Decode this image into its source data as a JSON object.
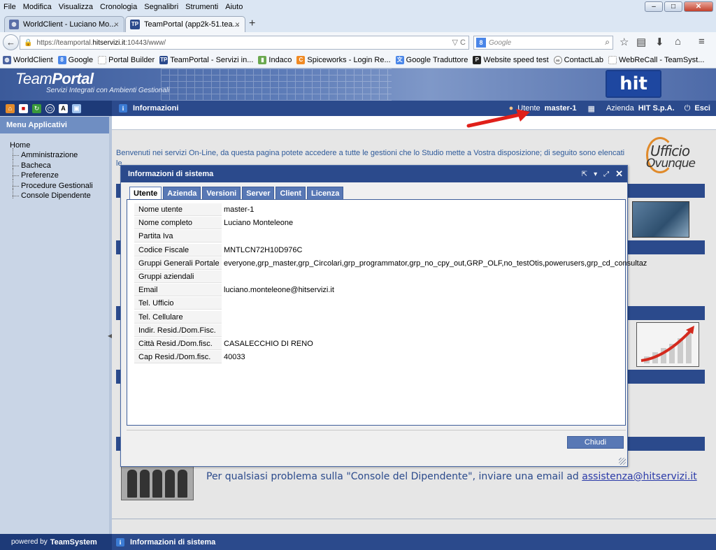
{
  "browser": {
    "menu": [
      "File",
      "Modifica",
      "Visualizza",
      "Cronologia",
      "Segnalibri",
      "Strumenti",
      "Aiuto"
    ],
    "window_controls": {
      "minimize": "–",
      "maximize": "□",
      "close": "✕"
    },
    "tabs": [
      {
        "label": "WorldClient - Luciano Mo...",
        "icon": "worldclient-icon",
        "active": false
      },
      {
        "label": "TeamPortal (app2k-51.tea...",
        "icon": "tp-icon",
        "active": true
      }
    ],
    "new_tab": "+",
    "back": "←",
    "url": {
      "prefix": "https://teamportal.",
      "domain": "hitservizi.it",
      "suffix": ":10443/www/",
      "controls": "▽ C"
    },
    "search": {
      "placeholder": "Google",
      "engine_badge": "8",
      "icon": "⌕"
    },
    "nav_icons": [
      "☆",
      "▤",
      "⬇",
      "⌂",
      "≡"
    ],
    "bookmarks": [
      {
        "label": "WorldClient",
        "icon": "globe-icon"
      },
      {
        "label": "Google",
        "icon": "google-icon"
      },
      {
        "label": "Portal Builder",
        "icon": "page-icon"
      },
      {
        "label": "TeamPortal - Servizi in...",
        "icon": "tp-icon"
      },
      {
        "label": "Indaco",
        "icon": "chart-icon"
      },
      {
        "label": "Spiceworks - Login Re...",
        "icon": "spiceworks-icon"
      },
      {
        "label": "Google Traduttore",
        "icon": "translate-icon"
      },
      {
        "label": "Website speed test",
        "icon": "p-icon"
      },
      {
        "label": "ContactLab",
        "icon": "contactlab-icon"
      },
      {
        "label": "WebReCall - TeamSyst...",
        "icon": "page-icon"
      }
    ]
  },
  "app": {
    "brand_team": "Team",
    "brand_portal": "Portal",
    "brand_sub": "Servizi Integrati con Ambienti Gestionali",
    "hit_logo": "hit",
    "toolbar_icons": [
      "home-icon",
      "flag-icon",
      "refresh-icon",
      "power-icon",
      "font-icon",
      "windows-icon"
    ],
    "section_title": "Informazioni",
    "user_label": "Utente",
    "user_value": "master-1",
    "company_label": "Azienda",
    "company_value": "HIT S.p.A.",
    "logout_label": "Esci",
    "sidebar_title": "Menu Applicativi",
    "tree_root": "Home",
    "tree_items": [
      "Amministrazione",
      "Bacheca",
      "Preferenze",
      "Procedure Gestionali",
      "Console Dipendente"
    ],
    "welcome_text": "Benvenuti nei servizi On-Line, da questa pagina potete accedere a tutte le gestioni che lo Studio mette a Vostra disposizione; di seguito sono elencati le",
    "ufficio_1": "Ufficio",
    "ufficio_2": "Ovunque",
    "bottom_text": "Per qualsiasi problema sulla \"Console del Dipendente\", inviare una email ad",
    "bottom_email": "assistenza@hitservizi.it",
    "powered_by": "powered by",
    "powered_brand": "TeamSystem",
    "status_title": "Informazioni di sistema"
  },
  "dialog": {
    "title": "Informazioni di sistema",
    "header_buttons": [
      "⇱",
      "▾",
      "⤢",
      "✕"
    ],
    "tabs": [
      "Utente",
      "Azienda",
      "Versioni",
      "Server",
      "Client",
      "Licenza"
    ],
    "active_tab": "Utente",
    "rows": [
      {
        "label": "Nome utente",
        "value": "master-1"
      },
      {
        "label": "Nome completo",
        "value": "Luciano Monteleone"
      },
      {
        "label": "Partita Iva",
        "value": ""
      },
      {
        "label": "Codice Fiscale",
        "value": "MNTLCN72H10D976C"
      },
      {
        "label": "Gruppi Generali Portale",
        "value": "everyone,grp_master,grp_Circolari,grp_programmator,grp_no_cpy_out,GRP_OLF,no_testOtis,powerusers,grp_cd_consultaz"
      },
      {
        "label": "Gruppi aziendali",
        "value": ""
      },
      {
        "label": "Email",
        "value": "luciano.monteleone@hitservizi.it"
      },
      {
        "label": "Tel. Ufficio",
        "value": ""
      },
      {
        "label": "Tel. Cellulare",
        "value": ""
      },
      {
        "label": "Indir. Resid./Dom.Fisc.",
        "value": ""
      },
      {
        "label": "Città Resid./Dom.fisc.",
        "value": "CASALECCHIO DI RENO"
      },
      {
        "label": "Cap Resid./Dom.fisc.",
        "value": "40033"
      }
    ],
    "close_button": "Chiudi"
  },
  "colors": {
    "brand_blue": "#2b4a8c",
    "dark_blue": "#1d3a78",
    "tab_blue": "#5878b5",
    "sidebar_bg": "#c9d5e6",
    "arrow_red": "#e0201a"
  }
}
